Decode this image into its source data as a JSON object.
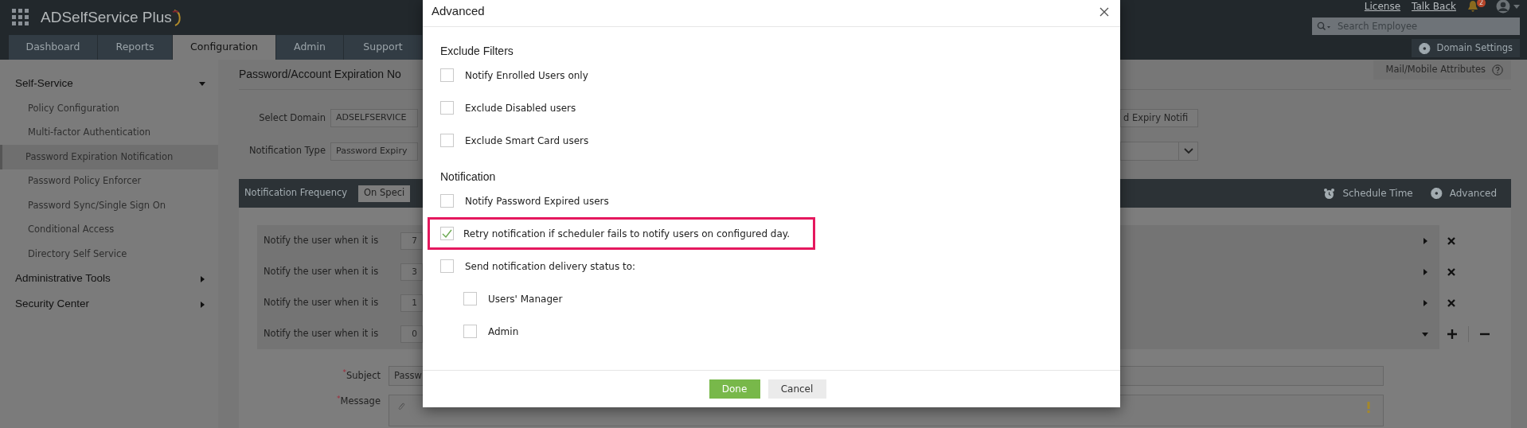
{
  "header": {
    "app_name": "ADSelfService Plus",
    "links": [
      "License",
      "Talk Back"
    ],
    "notification_count": "2",
    "search": {
      "placeholder": "Search Employee"
    },
    "domain_settings": "Domain Settings"
  },
  "tabs": [
    {
      "label": "Dashboard",
      "selected": false
    },
    {
      "label": "Reports",
      "selected": false
    },
    {
      "label": "Configuration",
      "selected": true
    },
    {
      "label": "Admin",
      "selected": false
    },
    {
      "label": "Support",
      "selected": false
    }
  ],
  "sidebar": [
    {
      "label": "Self-Service",
      "expanded": true,
      "children": [
        {
          "label": "Policy Configuration",
          "selected": false
        },
        {
          "label": "Multi-factor Authentication",
          "selected": false
        },
        {
          "label": "Password Expiration Notification",
          "selected": true
        },
        {
          "label": "Password Policy Enforcer",
          "selected": false
        },
        {
          "label": "Password Sync/Single Sign On",
          "selected": false
        },
        {
          "label": "Conditional Access",
          "selected": false
        },
        {
          "label": "Directory Self Service",
          "selected": false
        }
      ]
    },
    {
      "label": "Administrative Tools",
      "expanded": false
    },
    {
      "label": "Security Center",
      "expanded": false
    }
  ],
  "page": {
    "title": "Password/Account Expiration No",
    "help_button": "Mail/Mobile Attributes",
    "fields": [
      {
        "label": "Select Domain",
        "value": "ADSELFSERVICE",
        "side_field": {
          "kind": "text",
          "value": "d Expiry Notifi"
        }
      },
      {
        "label": "Notification Type",
        "value": "Password Expiry",
        "side_field": {
          "kind": "dropdown"
        }
      }
    ],
    "frequency": {
      "label": "Notification Frequency",
      "value": "On Speci",
      "actions": [
        {
          "label": "Schedule Time",
          "kind": "schedule"
        },
        {
          "label": "Advanced",
          "kind": "settings"
        }
      ]
    },
    "rules": [
      {
        "label": "Notify the user when it is",
        "value": "7",
        "expanded": false
      },
      {
        "label": "Notify the user when it is",
        "value": "3",
        "expanded": false
      },
      {
        "label": "Notify the user when it is",
        "value": "1",
        "expanded": false
      },
      {
        "label": "Notify the user when it is",
        "value": "0",
        "expanded": true
      }
    ],
    "subject": {
      "label": "$^{*}$Subject",
      "value": "Passw"
    },
    "message": {
      "label": "$^{*}$Message"
    }
  },
  "dialog": {
    "title": "Advanced",
    "sections": [
      {
        "heading": "Exclude Filters",
        "options": [
          {
            "label": "Notify Enrolled Users only",
            "checked": false,
            "highlighted": false
          },
          {
            "label": "Exclude Disabled users",
            "checked": false,
            "highlighted": false
          },
          {
            "label": "Exclude Smart Card users",
            "checked": false,
            "highlighted": false
          }
        ]
      },
      {
        "heading": "Notification",
        "options": [
          {
            "label": "Notify Password Expired users",
            "checked": false,
            "highlighted": false
          },
          {
            "label": "Retry notification if scheduler fails to notify users on configured day.",
            "checked": true,
            "highlighted": true
          },
          {
            "label": "Send notification delivery status to:",
            "checked": false,
            "highlighted": false,
            "children": [
              {
                "label": "Users' Manager",
                "checked": false,
                "highlighted": false
              },
              {
                "label": "Admin",
                "checked": false,
                "highlighted": false
              }
            ]
          }
        ]
      }
    ],
    "buttons": [
      {
        "label": "Done",
        "kind": "primary"
      },
      {
        "label": "Cancel",
        "kind": "secondary"
      }
    ]
  }
}
